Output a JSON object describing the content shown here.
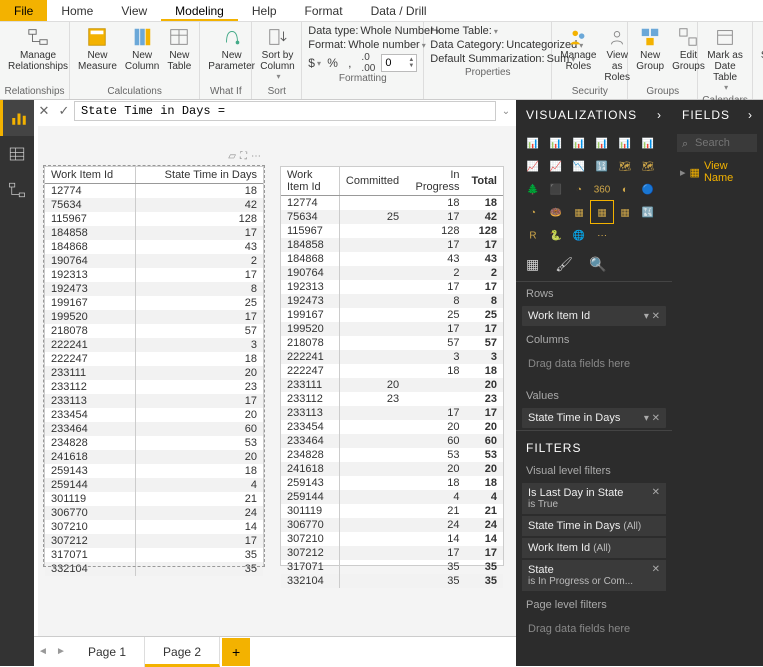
{
  "tabs": [
    "File",
    "Home",
    "View",
    "Modeling",
    "Help",
    "Format",
    "Data / Drill"
  ],
  "active_tab": "Modeling",
  "ribbon": {
    "relationships": {
      "label": "Relationships",
      "manage": "Manage\nRelationships"
    },
    "calculations": {
      "label": "Calculations",
      "new_measure": "New\nMeasure",
      "new_column": "New\nColumn",
      "new_table": "New\nTable"
    },
    "whatif": {
      "label": "What If",
      "new_parameter": "New\nParameter"
    },
    "sort": {
      "label": "Sort",
      "sort_by": "Sort by\nColumn"
    },
    "formatting": {
      "label": "Formatting",
      "data_type_lbl": "Data type:",
      "data_type_val": "Whole Number",
      "format_lbl": "Format:",
      "format_val": "Whole number",
      "decimals": "0"
    },
    "properties": {
      "label": "Properties",
      "home_table_lbl": "Home Table:",
      "data_category_lbl": "Data Category:",
      "data_category_val": "Uncategorized",
      "default_sum_lbl": "Default Summarization:",
      "default_sum_val": "Sum"
    },
    "security": {
      "label": "Security",
      "manage": "Manage\nRoles",
      "view": "View as\nRoles"
    },
    "groups": {
      "label": "Groups",
      "new": "New\nGroup",
      "edit": "Edit\nGroups"
    },
    "calendars": {
      "label": "Calendars",
      "mark": "Mark as\nDate Table"
    },
    "synonyms": "Synonym"
  },
  "formula": "State Time in Days =",
  "left_views": [
    "report",
    "data",
    "model"
  ],
  "table1": {
    "headers": [
      "Work Item Id",
      "State Time in Days"
    ],
    "rows": [
      [
        "12774",
        "18"
      ],
      [
        "75634",
        "42"
      ],
      [
        "115967",
        "128"
      ],
      [
        "184858",
        "17"
      ],
      [
        "184868",
        "43"
      ],
      [
        "190764",
        "2"
      ],
      [
        "192313",
        "17"
      ],
      [
        "192473",
        "8"
      ],
      [
        "199167",
        "25"
      ],
      [
        "199520",
        "17"
      ],
      [
        "218078",
        "57"
      ],
      [
        "222241",
        "3"
      ],
      [
        "222247",
        "18"
      ],
      [
        "233111",
        "20"
      ],
      [
        "233112",
        "23"
      ],
      [
        "233113",
        "17"
      ],
      [
        "233454",
        "20"
      ],
      [
        "233464",
        "60"
      ],
      [
        "234828",
        "53"
      ],
      [
        "241618",
        "20"
      ],
      [
        "259143",
        "18"
      ],
      [
        "259144",
        "4"
      ],
      [
        "301119",
        "21"
      ],
      [
        "306770",
        "24"
      ],
      [
        "307210",
        "14"
      ],
      [
        "307212",
        "17"
      ],
      [
        "317071",
        "35"
      ],
      [
        "332104",
        "35"
      ]
    ]
  },
  "table2": {
    "headers": [
      "Work Item Id",
      "Committed",
      "In Progress",
      "Total"
    ],
    "rows": [
      [
        "12774",
        "",
        "18",
        "18"
      ],
      [
        "75634",
        "25",
        "17",
        "42"
      ],
      [
        "115967",
        "",
        "128",
        "128"
      ],
      [
        "184858",
        "",
        "17",
        "17"
      ],
      [
        "184868",
        "",
        "43",
        "43"
      ],
      [
        "190764",
        "",
        "2",
        "2"
      ],
      [
        "192313",
        "",
        "17",
        "17"
      ],
      [
        "192473",
        "",
        "8",
        "8"
      ],
      [
        "199167",
        "",
        "25",
        "25"
      ],
      [
        "199520",
        "",
        "17",
        "17"
      ],
      [
        "218078",
        "",
        "57",
        "57"
      ],
      [
        "222241",
        "",
        "3",
        "3"
      ],
      [
        "222247",
        "",
        "18",
        "18"
      ],
      [
        "233111",
        "20",
        "",
        "20"
      ],
      [
        "233112",
        "23",
        "",
        "23"
      ],
      [
        "233113",
        "",
        "17",
        "17"
      ],
      [
        "233454",
        "",
        "20",
        "20"
      ],
      [
        "233464",
        "",
        "60",
        "60"
      ],
      [
        "234828",
        "",
        "53",
        "53"
      ],
      [
        "241618",
        "",
        "20",
        "20"
      ],
      [
        "259143",
        "",
        "18",
        "18"
      ],
      [
        "259144",
        "",
        "4",
        "4"
      ],
      [
        "301119",
        "",
        "21",
        "21"
      ],
      [
        "306770",
        "",
        "24",
        "24"
      ],
      [
        "307210",
        "",
        "14",
        "14"
      ],
      [
        "307212",
        "",
        "17",
        "17"
      ],
      [
        "317071",
        "",
        "35",
        "35"
      ],
      [
        "332104",
        "",
        "35",
        "35"
      ]
    ]
  },
  "pages": [
    "Page 1",
    "Page 2"
  ],
  "active_page": "Page 2",
  "viz_panel": {
    "title": "VISUALIZATIONS",
    "rows_lbl": "Rows",
    "row_field": "Work Item Id",
    "columns_lbl": "Columns",
    "columns_drop": "Drag data fields here",
    "values_lbl": "Values",
    "value_field": "State Time in Days",
    "filters_title": "FILTERS",
    "visual_filters_lbl": "Visual level filters",
    "filters": [
      {
        "name": "Is Last Day in State",
        "sub": "is True",
        "x": true
      },
      {
        "name": "State Time in Days",
        "sub": "(All)",
        "inline": true
      },
      {
        "name": "Work Item Id",
        "sub": "(All)",
        "inline": true
      },
      {
        "name": "State",
        "sub": "is In Progress or Com...",
        "x": true
      }
    ],
    "page_filters_lbl": "Page level filters",
    "page_drop": "Drag data fields here"
  },
  "fields_panel": {
    "title": "FIELDS",
    "search_ph": "Search",
    "items": [
      "View Name"
    ]
  }
}
